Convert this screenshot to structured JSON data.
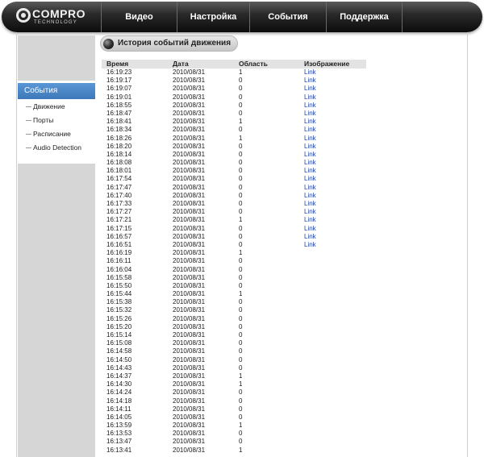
{
  "brand": {
    "name": "COMPRO",
    "sub": "TECHNOLOGY"
  },
  "nav": [
    "Видео",
    "Настройка",
    "События",
    "Поддержка"
  ],
  "sidebar": {
    "section": "События",
    "items": [
      "Движение",
      "Порты",
      "Расписание",
      "Audio Detection"
    ]
  },
  "page_title": "История событий движения",
  "table": {
    "headers": [
      "Время",
      "Дата",
      "Область",
      "Изображение"
    ],
    "rows": [
      [
        "16:19:23",
        "2010/08/31",
        "1",
        "Link"
      ],
      [
        "16:19:17",
        "2010/08/31",
        "0",
        "Link"
      ],
      [
        "16:19:07",
        "2010/08/31",
        "0",
        "Link"
      ],
      [
        "16:19:01",
        "2010/08/31",
        "0",
        "Link"
      ],
      [
        "16:18:55",
        "2010/08/31",
        "0",
        "Link"
      ],
      [
        "16:18:47",
        "2010/08/31",
        "0",
        "Link"
      ],
      [
        "16:18:41",
        "2010/08/31",
        "1",
        "Link"
      ],
      [
        "16:18:34",
        "2010/08/31",
        "0",
        "Link"
      ],
      [
        "16:18:26",
        "2010/08/31",
        "1",
        "Link"
      ],
      [
        "16:18:20",
        "2010/08/31",
        "0",
        "Link"
      ],
      [
        "16:18:14",
        "2010/08/31",
        "0",
        "Link"
      ],
      [
        "16:18:08",
        "2010/08/31",
        "0",
        "Link"
      ],
      [
        "16:18:01",
        "2010/08/31",
        "0",
        "Link"
      ],
      [
        "16:17:54",
        "2010/08/31",
        "0",
        "Link"
      ],
      [
        "16:17:47",
        "2010/08/31",
        "0",
        "Link"
      ],
      [
        "16:17:40",
        "2010/08/31",
        "0",
        "Link"
      ],
      [
        "16:17:33",
        "2010/08/31",
        "0",
        "Link"
      ],
      [
        "16:17:27",
        "2010/08/31",
        "0",
        "Link"
      ],
      [
        "16:17:21",
        "2010/08/31",
        "1",
        "Link"
      ],
      [
        "16:17:15",
        "2010/08/31",
        "0",
        "Link"
      ],
      [
        "16:16:57",
        "2010/08/31",
        "0",
        "Link"
      ],
      [
        "16:16:51",
        "2010/08/31",
        "0",
        "Link"
      ],
      [
        "16:16:19",
        "2010/08/31",
        "1",
        ""
      ],
      [
        "16:16:11",
        "2010/08/31",
        "0",
        ""
      ],
      [
        "16:16:04",
        "2010/08/31",
        "0",
        ""
      ],
      [
        "16:15:58",
        "2010/08/31",
        "0",
        ""
      ],
      [
        "16:15:50",
        "2010/08/31",
        "0",
        ""
      ],
      [
        "16:15:44",
        "2010/08/31",
        "1",
        ""
      ],
      [
        "16:15:38",
        "2010/08/31",
        "0",
        ""
      ],
      [
        "16:15:32",
        "2010/08/31",
        "0",
        ""
      ],
      [
        "16:15:26",
        "2010/08/31",
        "0",
        ""
      ],
      [
        "16:15:20",
        "2010/08/31",
        "0",
        ""
      ],
      [
        "16:15:14",
        "2010/08/31",
        "0",
        ""
      ],
      [
        "16:15:08",
        "2010/08/31",
        "0",
        ""
      ],
      [
        "16:14:58",
        "2010/08/31",
        "0",
        ""
      ],
      [
        "16:14:50",
        "2010/08/31",
        "0",
        ""
      ],
      [
        "16:14:43",
        "2010/08/31",
        "0",
        ""
      ],
      [
        "16:14:37",
        "2010/08/31",
        "1",
        ""
      ],
      [
        "16:14:30",
        "2010/08/31",
        "1",
        ""
      ],
      [
        "16:14:24",
        "2010/08/31",
        "0",
        ""
      ],
      [
        "16:14:18",
        "2010/08/31",
        "0",
        ""
      ],
      [
        "16:14:11",
        "2010/08/31",
        "0",
        ""
      ],
      [
        "16:14:05",
        "2010/08/31",
        "0",
        ""
      ],
      [
        "16:13:59",
        "2010/08/31",
        "1",
        ""
      ],
      [
        "16:13:53",
        "2010/08/31",
        "0",
        ""
      ],
      [
        "16:13:47",
        "2010/08/31",
        "0",
        ""
      ],
      [
        "16:13:41",
        "2010/08/31",
        "1",
        ""
      ]
    ]
  },
  "colors": {
    "sidebar_active": "#4a88c8",
    "link": "#2244aa",
    "topbar": "#1a1a1a",
    "sidebar_bg": "#d6d6d6"
  }
}
